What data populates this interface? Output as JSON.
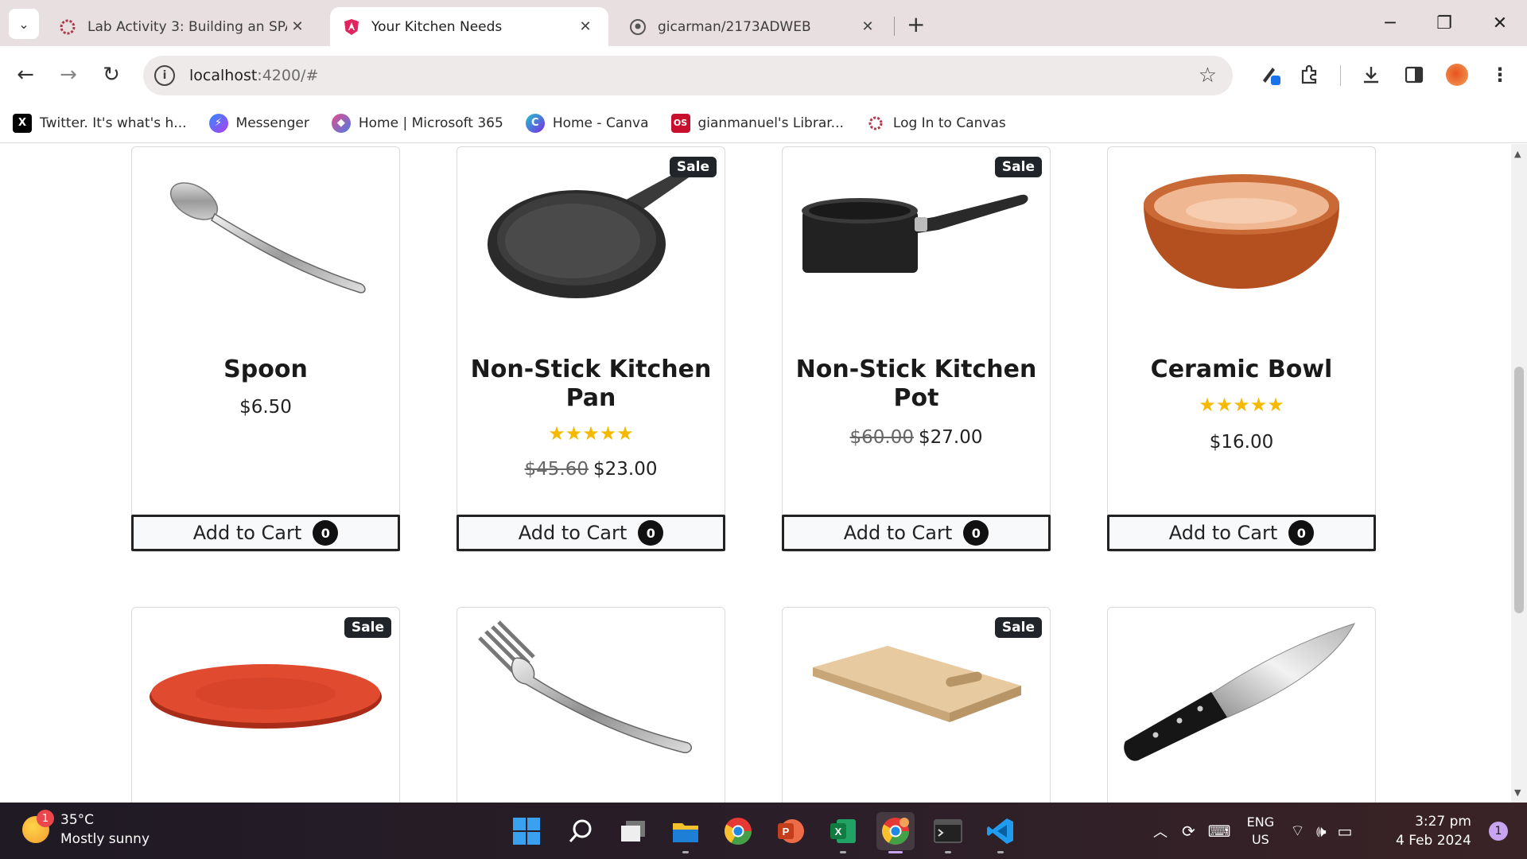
{
  "browser": {
    "tabs": [
      {
        "title": "Lab Activity 3: Building an SPA f",
        "active": false
      },
      {
        "title": "Your Kitchen Needs",
        "active": true
      },
      {
        "title": "gicarman/2173ADWEB",
        "active": false
      }
    ],
    "url_host": "localhost",
    "url_path": ":4200/#",
    "bookmarks": [
      {
        "label": "Twitter. It's what's h...",
        "icon": "x-logo-icon",
        "color": "#000000",
        "glyph": "X"
      },
      {
        "label": "Messenger",
        "icon": "messenger-icon",
        "color": "#8a45f0",
        "glyph": "✉"
      },
      {
        "label": "Home | Microsoft 365",
        "icon": "microsoft365-icon",
        "color": "#5b6bd8",
        "glyph": "◆"
      },
      {
        "label": "Home - Canva",
        "icon": "canva-icon",
        "color": "#1aa3d6",
        "glyph": "C"
      },
      {
        "label": "gianmanuel's Librar...",
        "icon": "library-icon",
        "color": "#c8102e",
        "glyph": "OS"
      },
      {
        "label": "Log In to Canvas",
        "icon": "canvas-icon",
        "color": "#b0394b",
        "glyph": "✻"
      }
    ]
  },
  "products": [
    {
      "name": "Spoon",
      "sale": false,
      "stars": "",
      "old_price": "",
      "price": "$6.50",
      "cart_label": "Add to Cart",
      "cart_count": "0"
    },
    {
      "name": "Non-Stick Kitchen Pan",
      "sale": true,
      "stars": "★★★★★",
      "old_price": "$45.60",
      "price": "$23.00",
      "cart_label": "Add to Cart",
      "cart_count": "0"
    },
    {
      "name": "Non-Stick Kitchen Pot",
      "sale": true,
      "stars": "",
      "old_price": "$60.00",
      "price": "$27.00",
      "cart_label": "Add to Cart",
      "cart_count": "0"
    },
    {
      "name": "Ceramic Bowl",
      "sale": false,
      "stars": "★★★★★",
      "old_price": "",
      "price": "$16.00",
      "cart_label": "Add to Cart",
      "cart_count": "0"
    },
    {
      "sale": true
    },
    {
      "sale": false
    },
    {
      "sale": true
    },
    {
      "sale": false
    }
  ],
  "sale_label": "Sale",
  "taskbar": {
    "temperature": "35°C",
    "weather": "Mostly sunny",
    "weather_badge": "1",
    "language": "ENG",
    "region": "US",
    "time": "3:27 pm",
    "date": "4 Feb 2024",
    "notifications": "1"
  }
}
